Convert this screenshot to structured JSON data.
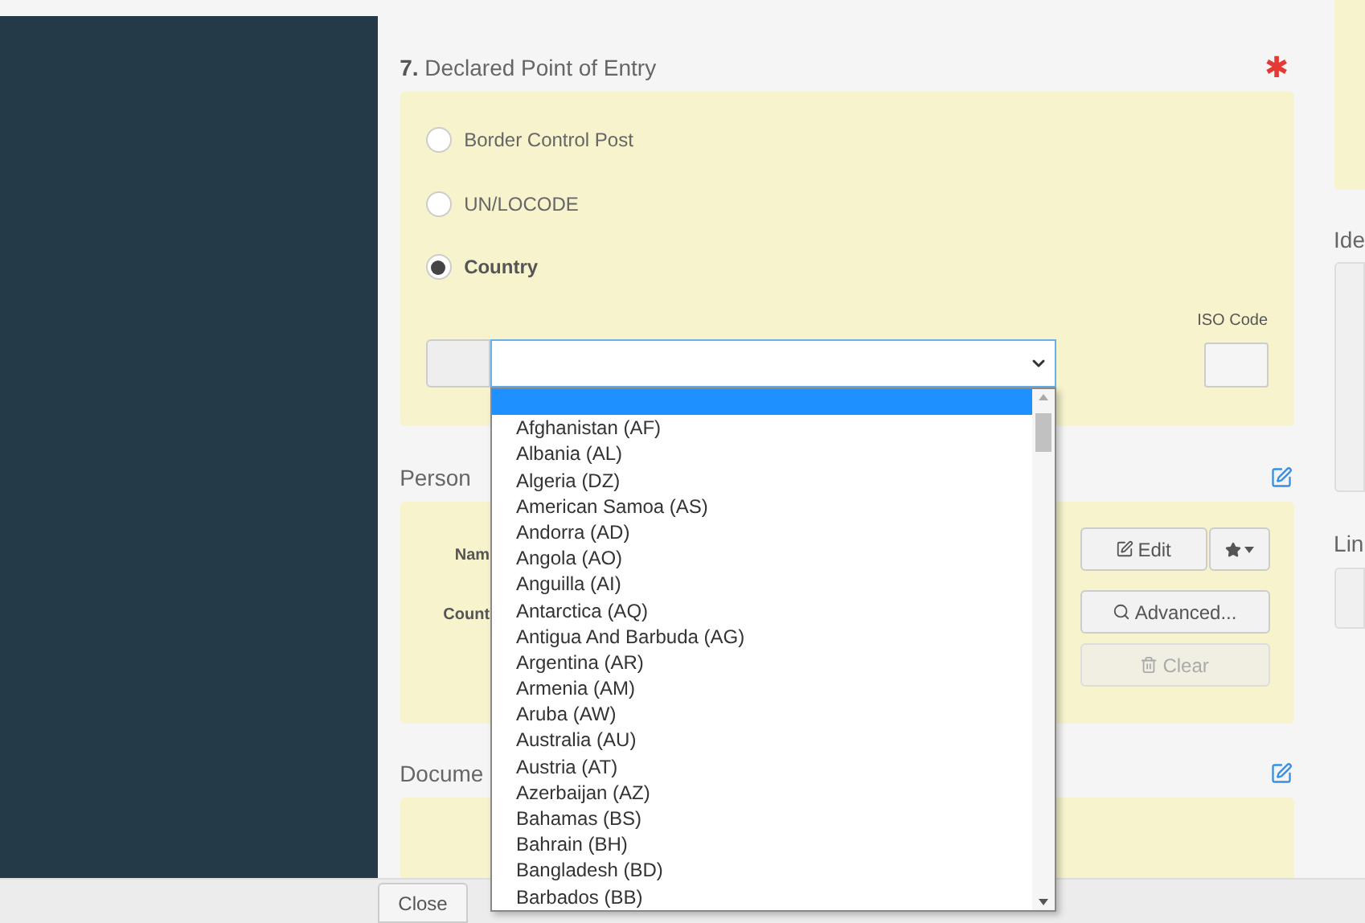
{
  "entry_section": {
    "number": "7.",
    "title": "Declared Point of Entry",
    "required_mark": "✱",
    "options": [
      {
        "label": "Border Control Post",
        "selected": false
      },
      {
        "label": "UN/LOCODE",
        "selected": false
      },
      {
        "label": "Country",
        "selected": true
      }
    ],
    "iso_label": "ISO Code",
    "country_dropdown": {
      "items": [
        {
          "selected": true
        },
        {
          "label": "Afghanistan (AF)",
          "selected": false
        },
        {
          "label": "Albania (AL)",
          "selected": false
        },
        {
          "label": "Algeria (DZ)",
          "selected": false
        },
        {
          "label": "American Samoa (AS)",
          "selected": false
        },
        {
          "label": "Andorra (AD)",
          "selected": false
        },
        {
          "label": "Angola (AO)",
          "selected": false
        },
        {
          "label": "Anguilla (AI)",
          "selected": false
        },
        {
          "label": "Antarctica (AQ)",
          "selected": false
        },
        {
          "label": "Antigua And Barbuda (AG)",
          "selected": false
        },
        {
          "label": "Argentina (AR)",
          "selected": false
        },
        {
          "label": "Armenia (AM)",
          "selected": false
        },
        {
          "label": "Aruba (AW)",
          "selected": false
        },
        {
          "label": "Australia (AU)",
          "selected": false
        },
        {
          "label": "Austria (AT)",
          "selected": false
        },
        {
          "label": "Azerbaijan (AZ)",
          "selected": false
        },
        {
          "label": "Bahamas (BS)",
          "selected": false
        },
        {
          "label": "Bahrain (BH)",
          "selected": false
        },
        {
          "label": "Bangladesh (BD)",
          "selected": false
        },
        {
          "label": "Barbados (BB)",
          "selected": false
        }
      ]
    }
  },
  "person_section": {
    "title": "Person",
    "fields": [
      "Nam",
      "Count"
    ],
    "buttons": [
      {
        "label": "Edit",
        "kind": "edit",
        "disabled": false
      },
      {
        "label": "Advanced...",
        "kind": "advanced",
        "disabled": false
      },
      {
        "label": "Clear",
        "kind": "clear",
        "disabled": true
      }
    ]
  },
  "document_section": {
    "title": "Docume"
  },
  "right_column": {
    "labels": [
      "Ide",
      "Lin"
    ]
  },
  "footer": {
    "close_button": "Close"
  }
}
